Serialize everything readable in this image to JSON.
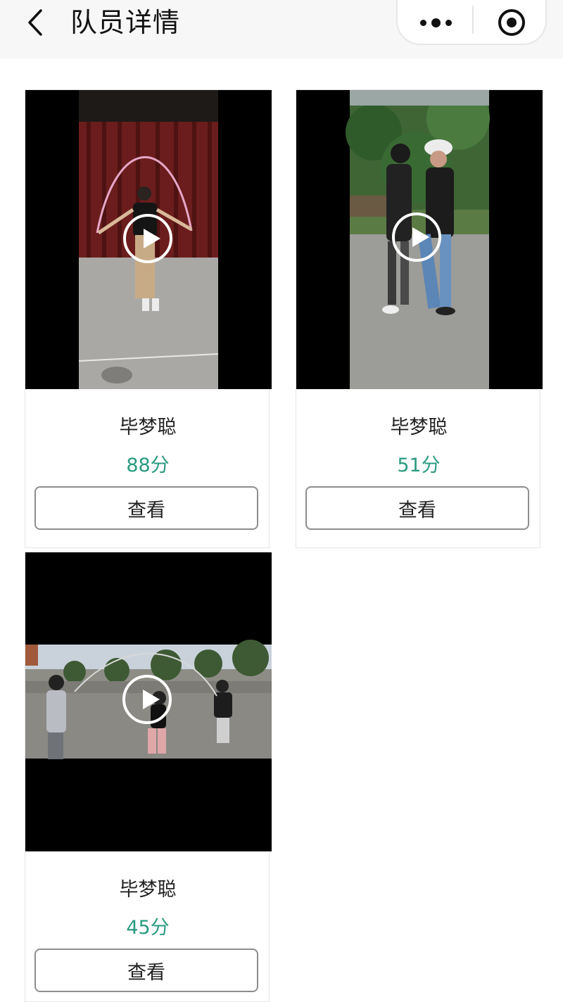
{
  "header": {
    "title": "队员详情",
    "back_icon": "chevron-left-icon",
    "more_icon": "more-dots-icon",
    "close_icon": "target-close-icon"
  },
  "cards": [
    {
      "name": "毕梦聪",
      "score": "88分",
      "button": "查看"
    },
    {
      "name": "毕梦聪",
      "score": "51分",
      "button": "查看"
    },
    {
      "name": "毕梦聪",
      "score": "45分",
      "button": "查看"
    }
  ],
  "colors": {
    "score": "#2a9a80",
    "topbar": "#f7f7f7",
    "button_border": "#8d8d8d"
  }
}
